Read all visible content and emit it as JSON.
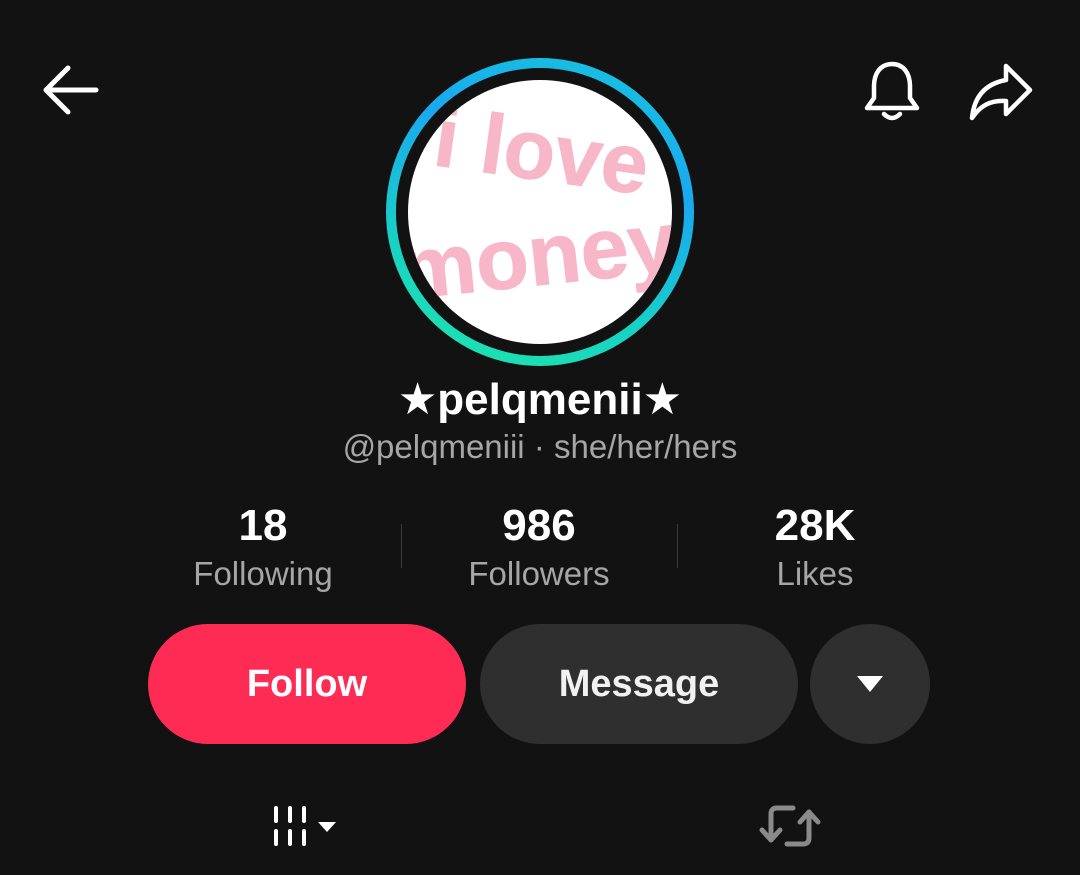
{
  "header": {
    "back_icon": "arrow-left-icon",
    "notification_icon": "bell-icon",
    "share_icon": "share-arrow-icon"
  },
  "profile": {
    "avatar_text_line1": "i love",
    "avatar_text_line2": "money",
    "display_name": "★pelqmenii★",
    "handle": "@pelqmeniii",
    "separator": "·",
    "pronouns": "she/her/hers"
  },
  "stats": {
    "following": {
      "value": "18",
      "label": "Following"
    },
    "followers": {
      "value": "986",
      "label": "Followers"
    },
    "likes": {
      "value": "28K",
      "label": "Likes"
    }
  },
  "actions": {
    "follow_label": "Follow",
    "message_label": "Message",
    "more_icon": "caret-down-icon"
  },
  "tabs": [
    {
      "icon": "video-grid-icon",
      "has_dropdown": true
    },
    {
      "icon": "repost-icon"
    }
  ],
  "colors": {
    "background": "#121212",
    "follow_button": "#fe2c55",
    "secondary_button": "#2f2f2f",
    "secondary_text": "#a6a6a6",
    "avatar_text": "#f7b7c8",
    "ring_gradient_start": "#1aa8f0",
    "ring_gradient_end": "#20e6a8"
  }
}
